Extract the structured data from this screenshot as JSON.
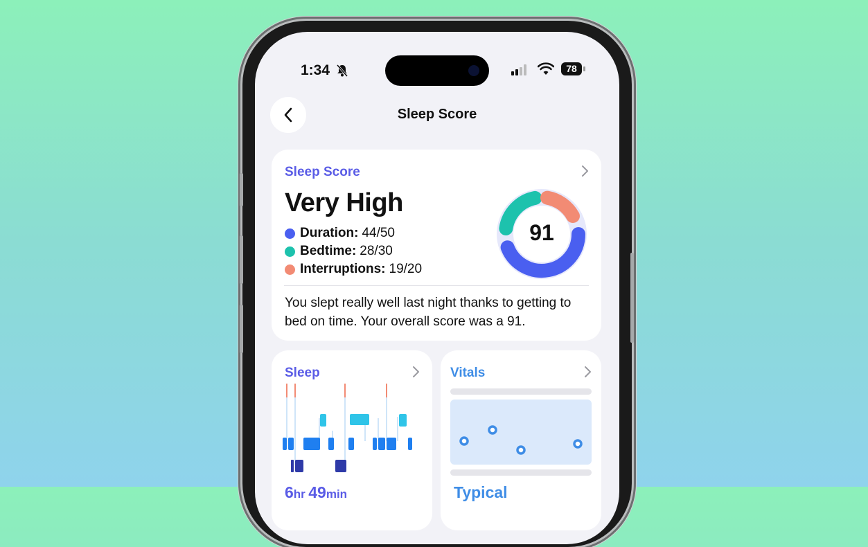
{
  "status_bar": {
    "time": "1:34",
    "battery": "78"
  },
  "nav": {
    "title": "Sleep Score"
  },
  "score_card": {
    "label": "Sleep Score",
    "rating": "Very High",
    "score": "91",
    "metrics": [
      {
        "name": "Duration:",
        "value": "44/50",
        "color": "#4a5ff0"
      },
      {
        "name": "Bedtime:",
        "value": "28/30",
        "color": "#1dc2ad"
      },
      {
        "name": "Interruptions:",
        "value": "19/20",
        "color": "#f28b74"
      }
    ],
    "summary": "You slept really well last night thanks to getting to bed on time. Your overall score was a 91."
  },
  "sleep_card": {
    "label": "Sleep",
    "hours": "6",
    "hours_unit": "hr",
    "minutes": "49",
    "minutes_unit": "min"
  },
  "vitals_card": {
    "label": "Vitals",
    "status": "Typical"
  },
  "colors": {
    "accent": "#5a5ce6",
    "vitals_blue": "#3f8de6",
    "awake": "#f28b74",
    "rem": "#2fc4e8",
    "core": "#1f7ff0",
    "deep": "#2e3aa8"
  }
}
